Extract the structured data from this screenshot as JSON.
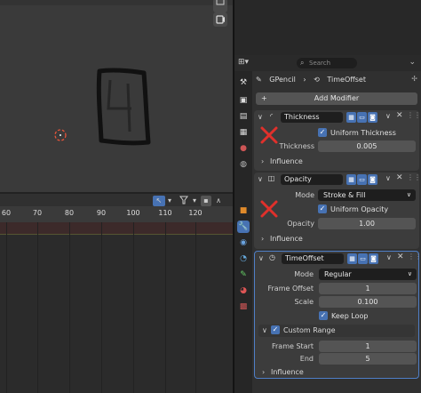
{
  "timeline": {
    "ticks": [
      "60",
      "70",
      "80",
      "90",
      "100",
      "110",
      "120"
    ]
  },
  "properties": {
    "search_placeholder": "Search",
    "breadcrumb": {
      "object": "GPencil",
      "modifier": "TimeOffset"
    },
    "add_modifier_label": "Add Modifier",
    "modifiers": [
      {
        "name": "Thickness",
        "checkbox": {
          "label": "Uniform Thickness",
          "checked": true
        },
        "fields": [
          {
            "label": "Thickness",
            "value": "0.005"
          }
        ],
        "subpanel": "Influence"
      },
      {
        "name": "Opacity",
        "mode": {
          "label": "Mode",
          "value": "Stroke & Fill"
        },
        "checkbox": {
          "label": "Uniform Opacity",
          "checked": true
        },
        "fields": [
          {
            "label": "Opacity",
            "value": "1.00"
          }
        ],
        "subpanel": "Influence"
      },
      {
        "name": "TimeOffset",
        "mode": {
          "label": "Mode",
          "value": "Regular"
        },
        "fields": [
          {
            "label": "Frame Offset",
            "value": "1"
          },
          {
            "label": "Scale",
            "value": "0.100"
          }
        ],
        "checkbox": {
          "label": "Keep Loop",
          "checked": true
        },
        "custom_range": {
          "label": "Custom Range",
          "checked": true,
          "fields": [
            {
              "label": "Frame Start",
              "value": "1"
            },
            {
              "label": "End",
              "value": "5"
            }
          ]
        },
        "subpanel": "Influence"
      }
    ]
  },
  "colors": {
    "accent": "#4772b3",
    "red_mark": "#e0302b",
    "cursor": "#e8553a"
  }
}
